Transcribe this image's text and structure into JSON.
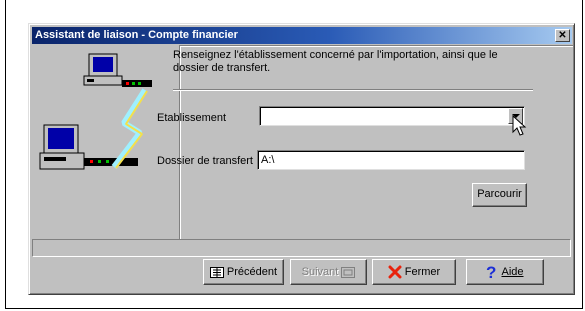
{
  "window": {
    "title": "Assistant de liaison - Compte financier",
    "close_glyph": "✕"
  },
  "content": {
    "instruction": "Renseignez l'établissement concerné par l'importation, ainsi que le dossier de transfert.",
    "etablissement_label": "Etablissement",
    "etablissement_value": "",
    "dossier_label": "Dossier de transfert",
    "dossier_value": "A:\\",
    "browse_label": "Parcourir"
  },
  "buttons": {
    "previous_label": "Précédent",
    "next_label": "Suivant",
    "close_label": "Fermer",
    "help_label": "Aide"
  },
  "icons": {
    "previous": "previous-page-icon",
    "next": "next-page-icon",
    "close": "red-x-icon",
    "help": "question-mark-icon"
  },
  "colors": {
    "title_start": "#0a246a",
    "title_end": "#a6caf0",
    "face": "#c0c0c0",
    "close_red": "#e8220c",
    "help_blue": "#1c2fd6"
  }
}
